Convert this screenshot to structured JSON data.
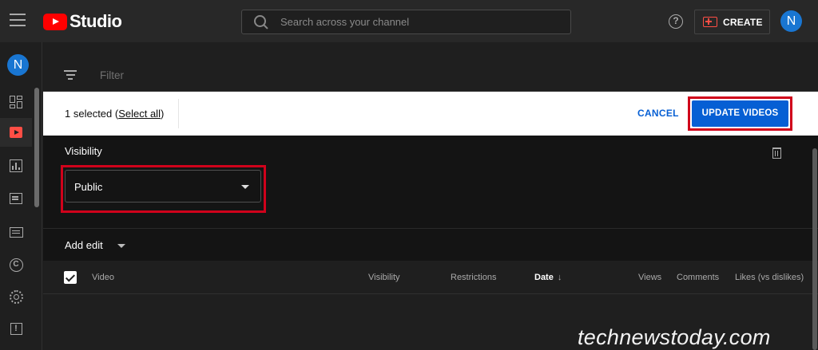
{
  "app": {
    "logo_text": "Studio",
    "avatar_letter": "N",
    "colors": {
      "accent": "#065fd4",
      "brand_red": "#ff0000",
      "highlight_box": "#d0021b",
      "avatar": "#1976d2"
    }
  },
  "header": {
    "menu_icon": "hamburger-icon",
    "search_placeholder": "Search across your channel",
    "help_glyph": "?",
    "create_label": "CREATE"
  },
  "sidebar": {
    "avatar_letter": "N",
    "items": [
      {
        "name": "dashboard",
        "icon": "dashboard-icon"
      },
      {
        "name": "content",
        "icon": "content-icon",
        "active": true
      },
      {
        "name": "analytics",
        "icon": "analytics-icon"
      },
      {
        "name": "comments",
        "icon": "comments-icon"
      },
      {
        "name": "subtitles",
        "icon": "subtitles-icon"
      },
      {
        "name": "copyright",
        "icon": "copyright-icon",
        "glyph": "C"
      },
      {
        "name": "settings",
        "icon": "gear-icon"
      },
      {
        "name": "feedback",
        "icon": "feedback-icon",
        "glyph": "!"
      }
    ]
  },
  "filter": {
    "label": "Filter"
  },
  "selection": {
    "count_text": "1 selected (",
    "select_all": "Select all",
    "close_paren": ")",
    "cancel": "CANCEL",
    "update": "UPDATE VIDEOS"
  },
  "edit_panel": {
    "visibility_label": "Visibility",
    "visibility_value": "Public",
    "add_edit": "Add edit"
  },
  "table": {
    "columns": {
      "video": "Video",
      "visibility": "Visibility",
      "restrictions": "Restrictions",
      "date": "Date",
      "views": "Views",
      "comments": "Comments",
      "likes": "Likes (vs dislikes)"
    },
    "sort_arrow": "↓",
    "select_all_checked": true
  },
  "watermark": "technewstoday.com"
}
